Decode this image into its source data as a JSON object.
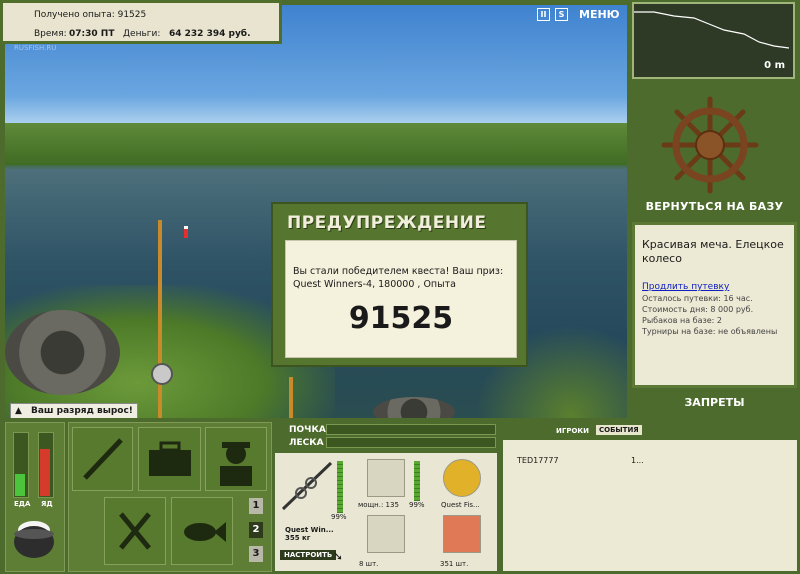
{
  "info": {
    "xp_label": "Получено опыта: 91525",
    "time_label": "Время:",
    "time_value": "07:30 ПТ",
    "money_label": "Деньги:",
    "money_value": "64 232 394 руб."
  },
  "watermark": "RUSFISH.RU",
  "top_buttons": {
    "pause": "II",
    "sound": "S",
    "menu": "МЕНЮ"
  },
  "map": {
    "depth": "0 m"
  },
  "right": {
    "return_button": "ВЕРНУТЬСЯ НА БАЗУ",
    "base_title": "Красивая меча. Елецкое колесо",
    "extend_link": "Продлить путевку",
    "lines": [
      "Осталось путевки: 16 час.",
      "Стоимость дня: 8 000 руб.",
      "Рыбаков на базе: 2",
      "Турниры на базе: не объявлены"
    ],
    "bans_button": "ЗАПРЕТЫ"
  },
  "warning": {
    "title": "ПРЕДУПРЕЖДЕНИЕ",
    "message": "Вы стали победителем квеста! Ваш приз: Quest Winners-4, 180000 , Опыта",
    "points": "91525"
  },
  "rank_notice": "Ваш разряд вырос!",
  "bottom": {
    "food_label": "ЕДА",
    "poison_label": "ЯД",
    "food_level": 0.35,
    "poison_level": 0.75,
    "pages": [
      "1",
      "2",
      "3"
    ],
    "float_label": "ПОЧКА",
    "line_label": "ЛЕСКА",
    "rod_name": "Quest Win...",
    "rod_weight": "355 кг",
    "rod_pct": "99%",
    "setup_button": "НАСТРОИТЬ",
    "reel_label": "мощн.: 135",
    "reel_pct": "99%",
    "line_item": "Quest Fis...",
    "hooks_count": "8 шт.",
    "bait_count": "351 шт.",
    "tabs": [
      "ИГРОКИ",
      "СОБЫТИЯ"
    ],
    "player_name": "TED17777",
    "player_value": "1..."
  },
  "colors": {
    "frame": "#4d6b2c",
    "panel_bg": "#ece9d4",
    "accent": "#56762f"
  }
}
